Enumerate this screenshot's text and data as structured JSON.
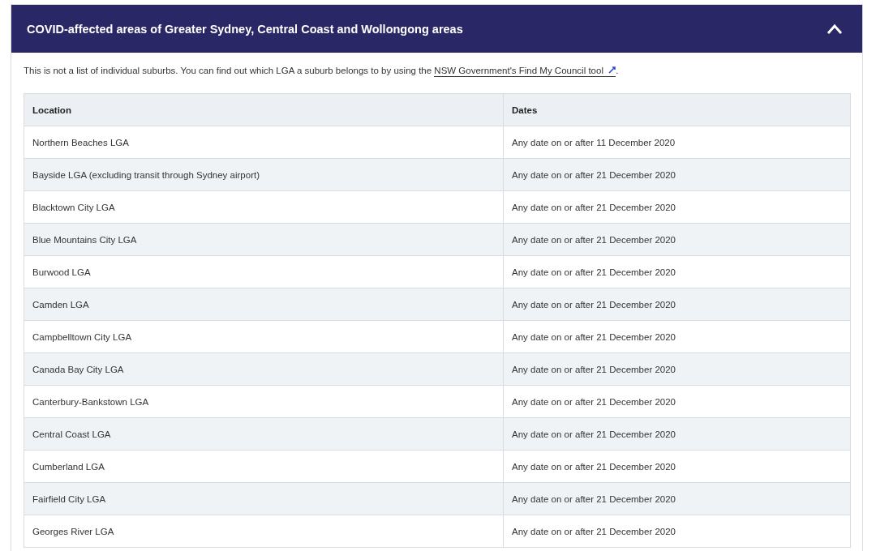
{
  "accordion": {
    "title": "COVID-affected areas of Greater Sydney, Central Coast and Wollongong areas",
    "expanded": true
  },
  "intro": {
    "text": "This is not a list of individual suburbs. You can find out which LGA a suburb belongs to by using the ",
    "link": "NSW Government's Find My Council tool",
    "after": "."
  },
  "table": {
    "columns": [
      "Location",
      "Dates"
    ],
    "rows": [
      [
        "Northern Beaches LGA",
        "Any date on or after 11 December 2020"
      ],
      [
        "Bayside LGA (excluding transit through Sydney airport)",
        "Any date on or after 21 December 2020"
      ],
      [
        "Blacktown City LGA",
        "Any date on or after 21 December 2020"
      ],
      [
        "Blue Mountains City LGA",
        "Any date on or after 21 December 2020"
      ],
      [
        "Burwood LGA",
        "Any date on or after 21 December 2020"
      ],
      [
        "Camden LGA",
        "Any date on or after 21 December 2020"
      ],
      [
        "Campbelltown City LGA",
        "Any date on or after 21 December 2020"
      ],
      [
        "Canada Bay City LGA",
        "Any date on or after 21 December 2020"
      ],
      [
        "Canterbury-Bankstown LGA",
        "Any date on or after 21 December 2020"
      ],
      [
        "Central Coast LGA",
        "Any date on or after 21 December 2020"
      ],
      [
        "Cumberland LGA",
        "Any date on or after 21 December 2020"
      ],
      [
        "Fairfield City LGA",
        "Any date on or after 21 December 2020"
      ],
      [
        "Georges River LGA",
        "Any date on or after 21 December 2020"
      ]
    ]
  }
}
